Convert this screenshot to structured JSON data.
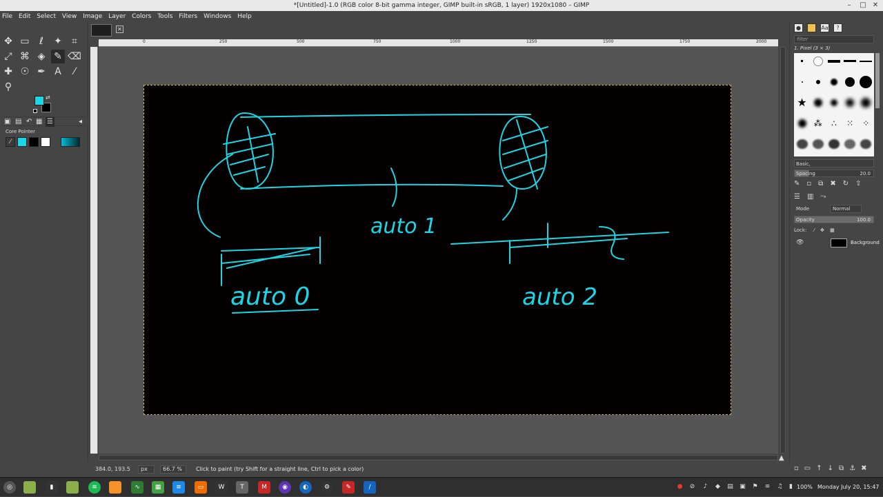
{
  "window": {
    "title": "*[Untitled]-1.0 (RGB color 8-bit gamma integer, GIMP built-in sRGB, 1 layer) 1920x1080 – GIMP"
  },
  "window_controls": [
    "–",
    "□",
    "✕"
  ],
  "menubar": [
    "File",
    "Edit",
    "Select",
    "View",
    "Image",
    "Layer",
    "Colors",
    "Tools",
    "Filters",
    "Windows",
    "Help"
  ],
  "toolbox": {
    "tools": [
      {
        "name": "move-tool-icon",
        "glyph": "✥"
      },
      {
        "name": "rect-select-icon",
        "glyph": "▭"
      },
      {
        "name": "lasso-icon",
        "glyph": "ℓ"
      },
      {
        "name": "fuzzy-select-icon",
        "glyph": "✦"
      },
      {
        "name": "crop-icon",
        "glyph": "⌗"
      },
      {
        "name": "transform-icon",
        "glyph": "⤢"
      },
      {
        "name": "warp-icon",
        "glyph": "⌘"
      },
      {
        "name": "bucket-fill-icon",
        "glyph": "◈"
      },
      {
        "name": "paintbrush-icon",
        "glyph": "✎"
      },
      {
        "name": "eraser-icon",
        "glyph": "⌫"
      },
      {
        "name": "heal-icon",
        "glyph": "✚"
      },
      {
        "name": "smudge-icon",
        "glyph": "☉"
      },
      {
        "name": "path-icon",
        "glyph": "✒"
      },
      {
        "name": "text-icon",
        "glyph": "A"
      },
      {
        "name": "color-picker-icon",
        "glyph": "⁄"
      },
      {
        "name": "zoom-icon",
        "glyph": "⚲"
      }
    ],
    "fg_color": "#1ad7e8",
    "bg_color": "#000000"
  },
  "core_pointer": {
    "label": "Core Pointer"
  },
  "rulers": {
    "h_ticks": [
      "0",
      "250",
      "500",
      "750",
      "1000",
      "1250",
      "1500",
      "1750",
      "2000"
    ]
  },
  "canvas_text": {
    "auto0": "auto 0",
    "auto1": "auto 1",
    "auto2": "auto 2"
  },
  "status": {
    "coords": "384.0, 193.5",
    "unit": "px",
    "zoom": "66.7 %",
    "message": "Click to paint (try Shift for a straight line, Ctrl to pick a color)"
  },
  "brushes": {
    "filter_placeholder": "filter",
    "selected": "1. Pixel (3 × 3)",
    "preset": "Basic,",
    "spacing_label": "Spacing",
    "spacing_value": "20.0"
  },
  "layers": {
    "mode_label": "Mode",
    "mode_value": "Normal",
    "opacity_label": "Opacity",
    "opacity_value": "100.0",
    "lock_label": "Lock:",
    "layer_name": "Background"
  },
  "taskbar": {
    "datetime": "Monday July 20, 15:47",
    "battery": "100%"
  },
  "colors": {
    "accent": "#1ad7e8",
    "canvas_bg": "#050000"
  }
}
